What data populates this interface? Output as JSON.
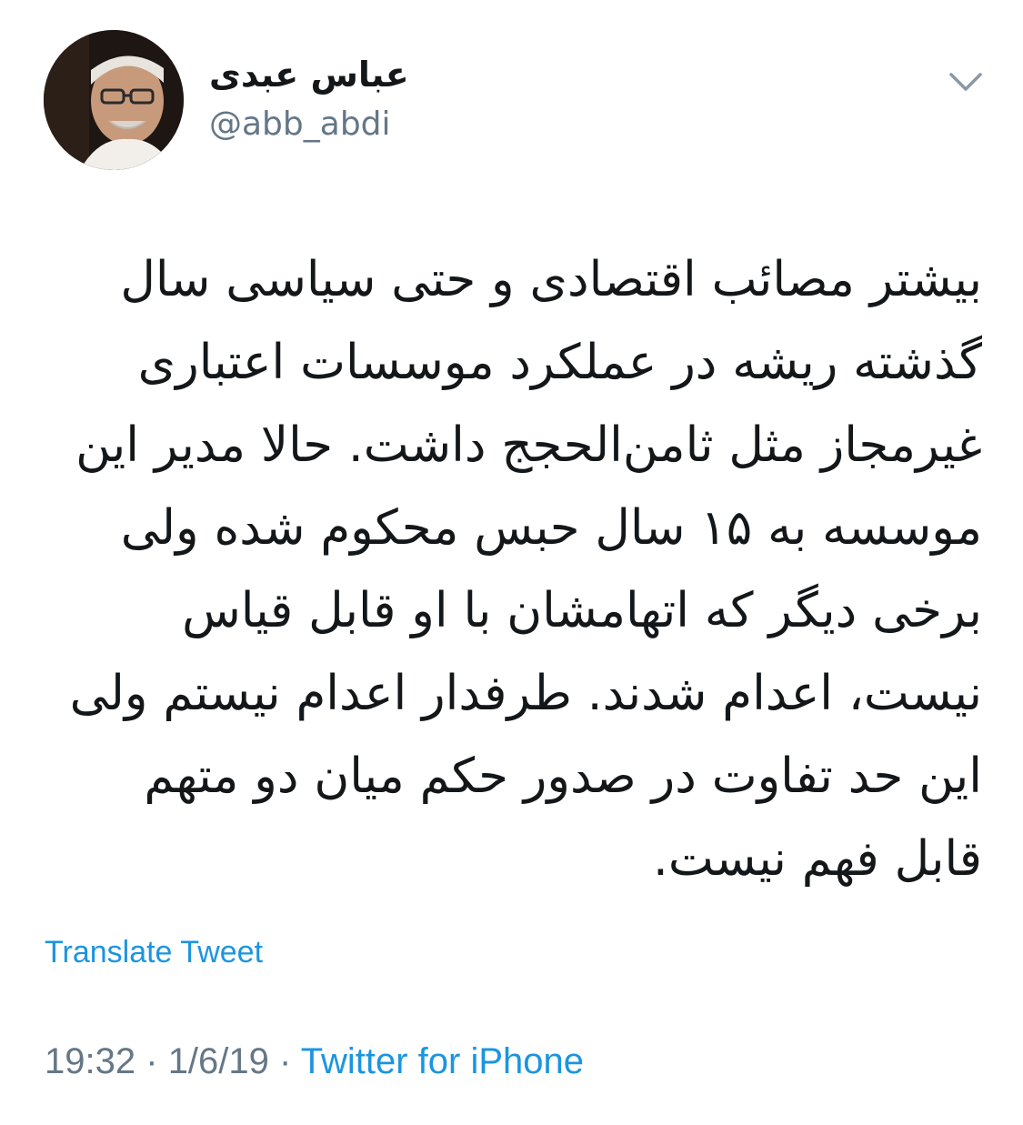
{
  "tweet": {
    "author": {
      "display_name": "عباس عبدی",
      "handle": "@abb_abdi"
    },
    "menu_icon": "chevron-down-icon",
    "text_lines": [
      "بیشتر مصائب اقتصادی و حتی سیاسی سال",
      "گذشته ریشه در عملکرد موسسات اعتباری",
      "غیرمجاز مثل ثامن‌الحجج داشت. حالا مدیر این",
      "موسسه به ۱۵ سال حبس محکوم شده ولی",
      "برخی دیگر که اتهامشان با او قابل قیاس",
      "نیست، اعدام شدند. طرفدار اعدام نیستم ولی",
      "این حد تفاوت در صدور حکم میان دو متهم",
      "قابل فهم نیست."
    ],
    "translate_label": "Translate Tweet",
    "time": "19:32",
    "separator": "·",
    "date": "1/6/19",
    "source": "Twitter for iPhone"
  },
  "colors": {
    "link": "#1b95e0",
    "secondary": "#657786",
    "text": "#14171a"
  }
}
